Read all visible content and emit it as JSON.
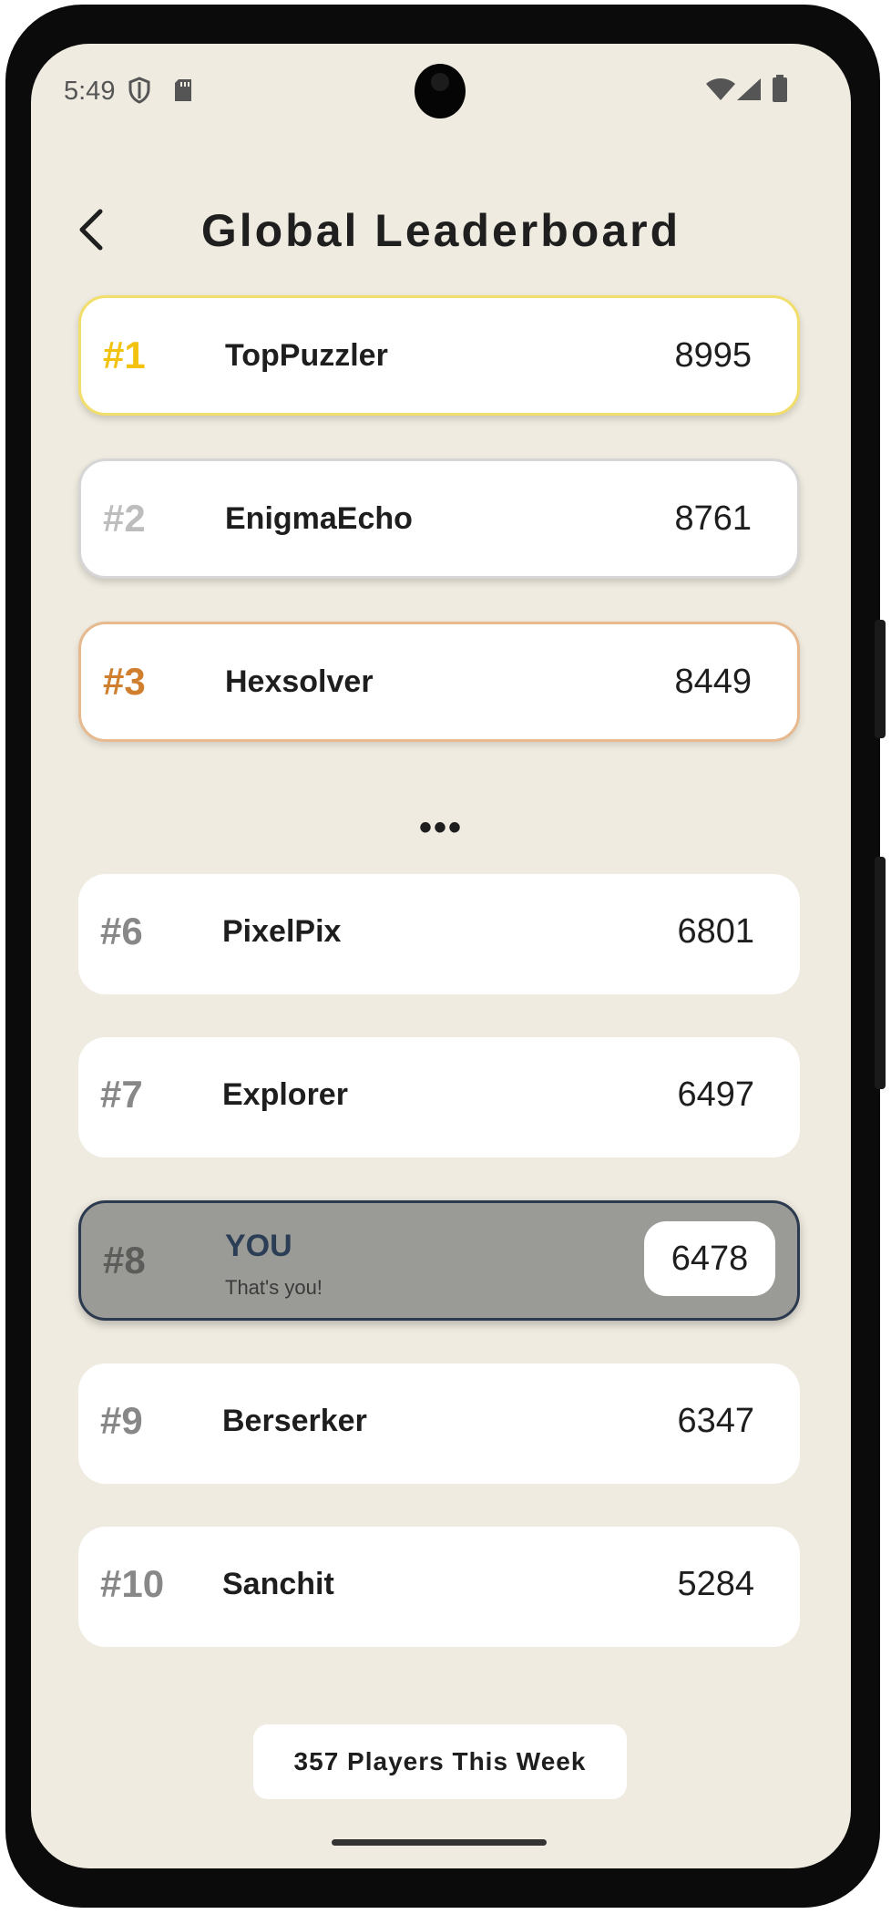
{
  "status_bar": {
    "time": "5:49",
    "icons": [
      "shield-icon",
      "sd-card-icon",
      "wifi-icon",
      "cellular-signal-icon",
      "battery-icon"
    ]
  },
  "header": {
    "back_icon": "chevron-left-icon",
    "title": "Global Leaderboard"
  },
  "leaderboard": {
    "top": [
      {
        "rank": "#1",
        "name": "TopPuzzler",
        "score": "8995",
        "accent": "#f2c20f"
      },
      {
        "rank": "#2",
        "name": "EnigmaEcho",
        "score": "8761",
        "accent": "#bdbdbd"
      },
      {
        "rank": "#3",
        "name": "Hexsolver",
        "score": "8449",
        "accent": "#d07f2e"
      }
    ],
    "gap_marker": "•••",
    "nearby": [
      {
        "rank": "#6",
        "name": "PixelPix",
        "score": "6801"
      },
      {
        "rank": "#7",
        "name": "Explorer",
        "score": "6497"
      }
    ],
    "you": {
      "rank": "#8",
      "name": "YOU",
      "subtitle": "That's you!",
      "score": "6478",
      "accent": "#2b3a4e"
    },
    "after": [
      {
        "rank": "#9",
        "name": "Berserker",
        "score": "6347"
      },
      {
        "rank": "#10",
        "name": "Sanchit",
        "score": "5284"
      }
    ]
  },
  "footer": {
    "players_label": "357 Players This Week"
  },
  "colors": {
    "background": "#efebe0",
    "card": "#ffffff",
    "you_card": "#9a9a96"
  }
}
